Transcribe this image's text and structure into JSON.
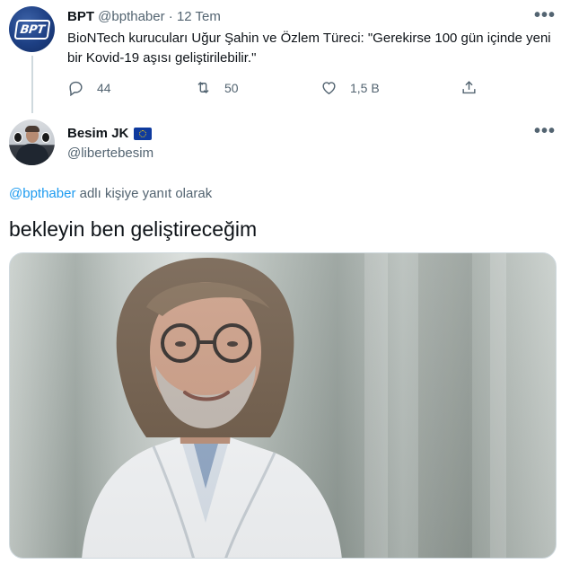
{
  "parent_tweet": {
    "avatar_logo": "BPT",
    "name": "BPT",
    "handle": "@bpthaber",
    "separator": "·",
    "time": "12 Tem",
    "text": "BioNTech kurucuları Uğur Şahin ve Özlem Türeci: \"Gerekirse 100 gün içinde yeni bir Kovid-19 aşısı geliştirilebilir.\"",
    "more": "•••",
    "actions": {
      "reply_count": "44",
      "retweet_count": "50",
      "like_count": "1,5 B"
    }
  },
  "reply_tweet": {
    "name": "Besim JK",
    "flag": "eu-flag-icon",
    "handle": "@libertebesim",
    "more": "•••",
    "reply_to_mention": "@bpthaber",
    "reply_to_suffix": " adlı kişiye yanıt olarak",
    "text": "bekleyin ben geliştireceğim"
  },
  "colors": {
    "accent": "#1d9bf0",
    "text": "#0f1419",
    "secondary_text": "#536471",
    "border": "#cfd9de"
  },
  "icons": [
    "reply-icon",
    "retweet-icon",
    "like-icon",
    "share-icon",
    "more-icon",
    "eu-flag-icon"
  ]
}
